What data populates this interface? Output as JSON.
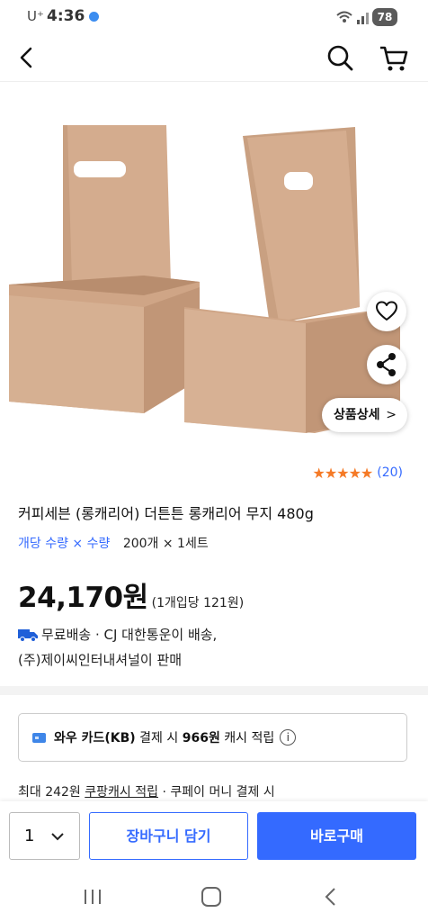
{
  "status_bar": {
    "carrier": "U⁺",
    "time": "4:36",
    "battery": "78"
  },
  "product": {
    "title": "커피세븐 (롱캐리어) 더튼튼 롱캐리어 무지 480g",
    "detail_button": "상품상세",
    "rating_stars": "★★★★★",
    "review_count": "(20)",
    "option_label": "개당 수량 × 수량",
    "option_value": "200개 × 1세트",
    "price": "24,170원",
    "unit_price": "(1개입당 121원)"
  },
  "shipping": {
    "line1": "무료배송 · CJ 대한통운이 배송,",
    "line2": "(주)제이씨인터내셔널이 판매"
  },
  "card_offer": {
    "prefix": "와우 카드(KB)",
    "middle": " 결제 시 ",
    "amount": "966원",
    "suffix": " 캐시 적립"
  },
  "cashback": {
    "prefix": "최대 242원 ",
    "link": "쿠팡캐시 적립",
    "suffix": " · 쿠페이 머니 결제 시"
  },
  "actions": {
    "quantity": "1",
    "add_to_cart": "장바구니 담기",
    "buy_now": "바로구매"
  },
  "colors": {
    "accent": "#346aff",
    "star": "#f57a26",
    "product_kraft": "#d2a886"
  }
}
